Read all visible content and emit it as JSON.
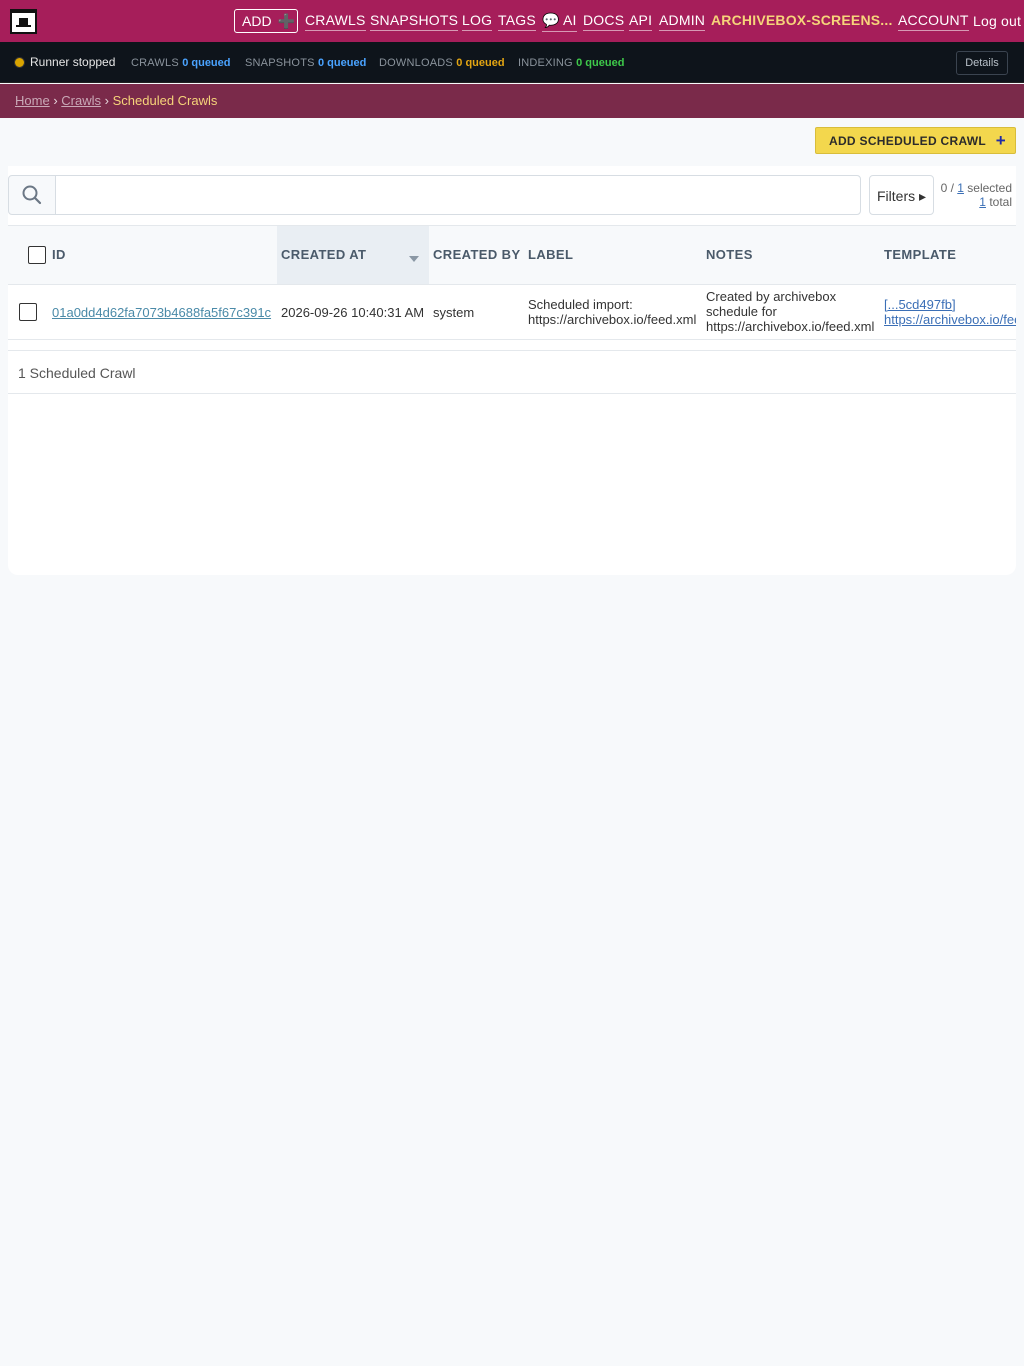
{
  "header": {
    "add_label": "ADD",
    "nav": [
      "CRAWLS",
      "SNAPSHOTS",
      "LOG",
      "TAGS",
      "💬 AI",
      "DOCS",
      "API",
      "ADMIN"
    ],
    "site_name": "ARCHIVEBOX-SCREENS...",
    "account": "ACCOUNT",
    "logout": "Log out"
  },
  "status": {
    "runner": "Runner stopped",
    "crawls_label": "CRAWLS",
    "crawls_value": "0 queued",
    "snapshots_label": "SNAPSHOTS",
    "snapshots_value": "0 queued",
    "downloads_label": "DOWNLOADS",
    "downloads_value": "0 queued",
    "indexing_label": "INDEXING",
    "indexing_value": "0 queued",
    "details": "Details",
    "colors": {
      "runner_dot": "#d9a400",
      "crawls": "#4aa3ff",
      "downloads": "#e3a512",
      "indexing": "#3ec94a"
    }
  },
  "breadcrumb": {
    "home": "Home",
    "sep": "›",
    "crawls": "Crawls",
    "current": "Scheduled Crawls"
  },
  "toolbar": {
    "add_scheduled": "ADD SCHEDULED CRAWL",
    "search_placeholder": "",
    "filters": "Filters ▸",
    "selected_count": "0",
    "selected_of": "1",
    "selected_word": "selected",
    "total_count": "1",
    "total_word": "total"
  },
  "table": {
    "columns": [
      "ID",
      "CREATED AT",
      "CREATED BY",
      "LABEL",
      "NOTES",
      "TEMPLATE"
    ],
    "rows": [
      {
        "id": "01a0dd4d62fa7073b4688fa5f67c391c",
        "created_at": "2026-09-26 10:40:31 AM",
        "created_by": "system",
        "label_line1": "Scheduled import:",
        "label_line2": "https://archivebox.io/feed.xml",
        "notes_line1": "Created by archivebox",
        "notes_line2": "schedule for",
        "notes_line3": "https://archivebox.io/feed.xml",
        "template_line1": "[...5cd497fb]",
        "template_line2": "https://archivebox.io/feed.xml"
      }
    ],
    "count_text": "1 Scheduled Crawl"
  },
  "colors": {
    "header": "#a61e5a",
    "breadcrumb": "#7a2a4a",
    "accent": "#f3d74d"
  }
}
